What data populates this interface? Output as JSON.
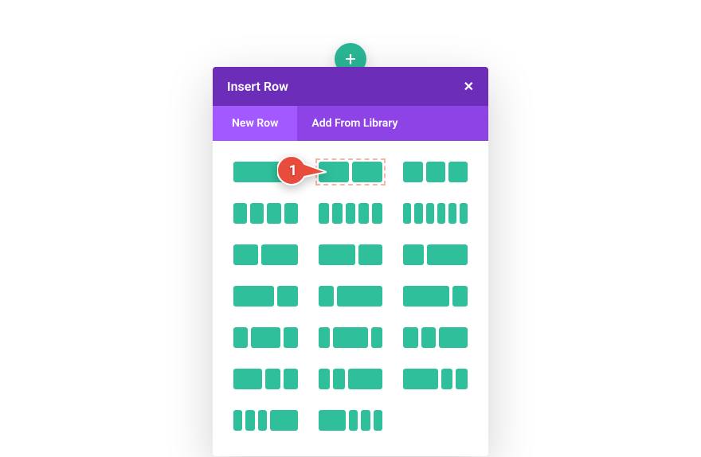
{
  "colors": {
    "accent": "#2fbf9b",
    "header": "#6c2eb9",
    "tabs_bg": "#8e43e7",
    "tab_active": "#a259ff",
    "callout": "#e84c3d",
    "highlight_border": "#f3b7a8"
  },
  "add_button": {
    "icon": "plus-icon",
    "glyph": "+"
  },
  "modal": {
    "title": "Insert Row",
    "close_glyph": "✕",
    "tabs": [
      {
        "id": "new_row",
        "label": "New Row",
        "active": true
      },
      {
        "id": "from_lib",
        "label": "Add From Library",
        "active": false
      }
    ]
  },
  "layouts_note": "Each entry is the fractional width of each column; highlighted=true means the dashed selection outline is drawn around it.",
  "layouts": [
    {
      "id": "1_1",
      "cols": [
        1
      ],
      "highlighted": false
    },
    {
      "id": "1_2__1_2",
      "cols": [
        0.5,
        0.5
      ],
      "highlighted": true
    },
    {
      "id": "1_3__1_3__1_3",
      "cols": [
        0.3333,
        0.3333,
        0.3333
      ],
      "highlighted": false
    },
    {
      "id": "1_4x4",
      "cols": [
        0.25,
        0.25,
        0.25,
        0.25
      ],
      "highlighted": false
    },
    {
      "id": "1_5x5",
      "cols": [
        0.2,
        0.2,
        0.2,
        0.2,
        0.2
      ],
      "highlighted": false
    },
    {
      "id": "1_6x6",
      "cols": [
        0.1667,
        0.1667,
        0.1667,
        0.1667,
        0.1667,
        0.1667
      ],
      "highlighted": false
    },
    {
      "id": "2_5__3_5",
      "cols": [
        0.4,
        0.6
      ],
      "highlighted": false
    },
    {
      "id": "3_5__2_5",
      "cols": [
        0.6,
        0.4
      ],
      "highlighted": false
    },
    {
      "id": "1_3__2_3",
      "cols": [
        0.3333,
        0.6667
      ],
      "highlighted": false
    },
    {
      "id": "2_3__1_3",
      "cols": [
        0.6667,
        0.3333
      ],
      "highlighted": false
    },
    {
      "id": "1_4__3_4",
      "cols": [
        0.25,
        0.75
      ],
      "highlighted": false
    },
    {
      "id": "3_4__1_4",
      "cols": [
        0.75,
        0.25
      ],
      "highlighted": false
    },
    {
      "id": "1_4__1_2__1_4",
      "cols": [
        0.25,
        0.5,
        0.25
      ],
      "highlighted": false
    },
    {
      "id": "1_5__3_5__1_5",
      "cols": [
        0.2,
        0.6,
        0.2
      ],
      "highlighted": false
    },
    {
      "id": "1_4__1_4__1_2",
      "cols": [
        0.25,
        0.25,
        0.5
      ],
      "highlighted": false
    },
    {
      "id": "1_2__1_4__1_4",
      "cols": [
        0.5,
        0.25,
        0.25
      ],
      "highlighted": false
    },
    {
      "id": "1_5__1_5__3_5",
      "cols": [
        0.2,
        0.2,
        0.6
      ],
      "highlighted": false
    },
    {
      "id": "3_5__1_5__1_5",
      "cols": [
        0.6,
        0.2,
        0.2
      ],
      "highlighted": false
    },
    {
      "id": "1_6x3__1_2",
      "cols": [
        0.1667,
        0.1667,
        0.1667,
        0.5
      ],
      "highlighted": false
    },
    {
      "id": "1_2__1_6x3",
      "cols": [
        0.5,
        0.1667,
        0.1667,
        0.1667
      ],
      "highlighted": false
    }
  ],
  "callout": {
    "number": "1",
    "points_to": "1_2__1_2"
  }
}
